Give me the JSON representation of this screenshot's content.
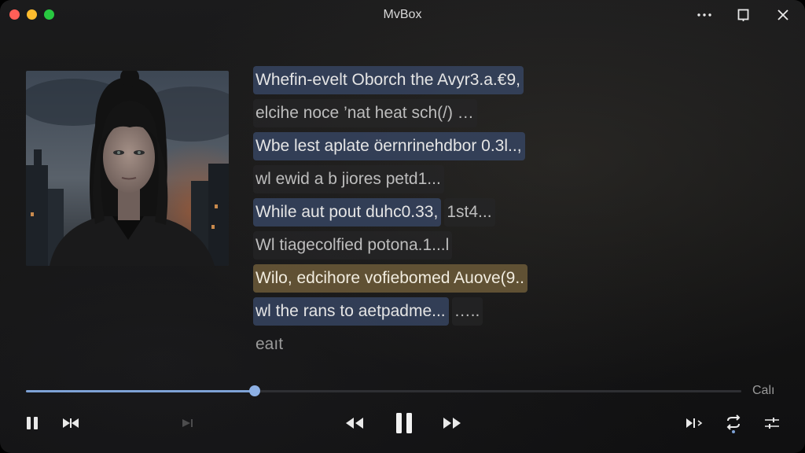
{
  "window": {
    "title": "MvBox"
  },
  "lyrics": [
    [
      {
        "text": "Whefin-evelt Oborch the Avyr3.a.€9,",
        "style": "blue"
      }
    ],
    [
      {
        "text": "elcihe noce ’nat heat sch(/) …",
        "style": "dim"
      }
    ],
    [
      {
        "text": "Wbe lest aplate öernrinehdbor 0.3l..,",
        "style": "blue"
      }
    ],
    [
      {
        "text": "wl ewid a b jiores  petd1...",
        "style": "dim"
      }
    ],
    [
      {
        "text": "While aut pout duhc0.33,",
        "style": "blue"
      },
      {
        "text": "1st4...",
        "style": "dim"
      }
    ],
    [
      {
        "text": "Wl tiagecolfied potona.1...l",
        "style": "dim"
      }
    ],
    [
      {
        "text": "Wilo, edcihore vofiebomed Auove(9..",
        "style": "gold"
      }
    ],
    [
      {
        "text": "wl the rans to aetpadme...",
        "style": "blue"
      },
      {
        "text": "…..",
        "style": "dim"
      }
    ],
    [
      {
        "text": "eaıt",
        "style": "faint"
      }
    ]
  ],
  "player": {
    "progress": 0.32,
    "time_label": "Calı"
  },
  "icons": {
    "more": "more-horizontal-icon",
    "restore": "window-restore-icon",
    "close": "close-icon",
    "pause_small": "pause-icon",
    "skip": "skip-icon",
    "rewind": "rewind-icon",
    "play_pause": "pause-icon",
    "forward": "fast-forward-icon",
    "queue": "next-track-icon",
    "repeat": "repeat-icon",
    "equalizer": "equalizer-icon"
  },
  "colors": {
    "accent": "#7ea2d6",
    "lyric_highlight_blue": "#364460",
    "lyric_highlight_gold": "#6c5a38"
  }
}
